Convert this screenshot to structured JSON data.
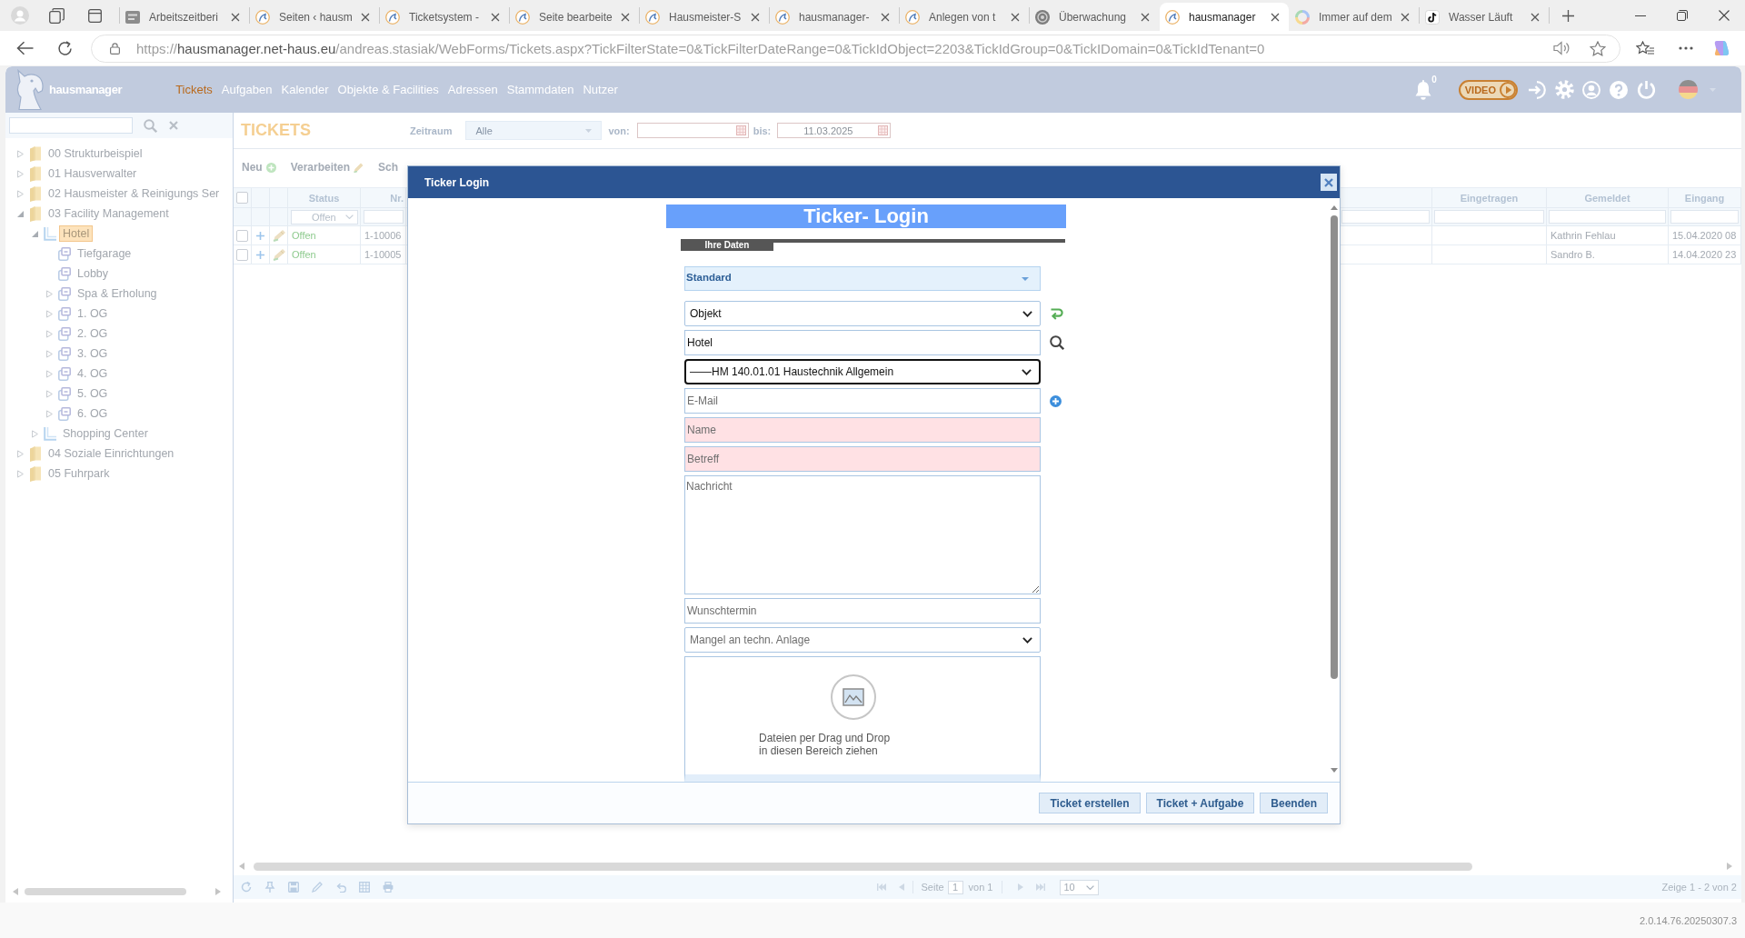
{
  "browser": {
    "tabs": [
      {
        "label": "Arbeitszeitberi",
        "kind": "tile",
        "selected": false
      },
      {
        "label": "Seiten ‹ hausm",
        "kind": "logo",
        "selected": false
      },
      {
        "label": "Ticketsystem -",
        "kind": "logo",
        "selected": false
      },
      {
        "label": "Seite bearbeite",
        "kind": "logo",
        "selected": false
      },
      {
        "label": "Hausmeister-S",
        "kind": "logo",
        "selected": false
      },
      {
        "label": "hausmanager-",
        "kind": "logo",
        "selected": false
      },
      {
        "label": "Anlegen von t",
        "kind": "logo",
        "selected": false
      },
      {
        "label": "Überwachung",
        "kind": "ring",
        "selected": false
      },
      {
        "label": "hausmanager",
        "kind": "logo",
        "selected": true
      },
      {
        "label": "Immer auf dem",
        "kind": "colors",
        "selected": false
      },
      {
        "label": "Wasser Läuft",
        "kind": "note",
        "selected": false
      }
    ],
    "address": {
      "scheme": "https://",
      "host": "hausmanager.net-haus.eu",
      "path": "/andreas.stasiak/WebForms/Tickets.aspx?TickFilterState=0&TickFilterDateRange=0&TickIdObject=2203&TickIdGroup=0&TickIDomain=0&TickIdTenant=0"
    }
  },
  "app": {
    "brand": "hausmanager",
    "nav": [
      {
        "label": "Tickets",
        "selected": true
      },
      {
        "label": "Aufgaben",
        "selected": false
      },
      {
        "label": "Kalender",
        "selected": false
      },
      {
        "label": "Objekte & Facilities",
        "selected": false
      },
      {
        "label": "Adressen",
        "selected": false
      },
      {
        "label": "Stammdaten",
        "selected": false
      },
      {
        "label": "Nutzer",
        "selected": false
      }
    ],
    "notifications": "0",
    "video": "VIDEO"
  },
  "sidebar": {
    "tree": [
      {
        "label": "00 Strukturbeispiel",
        "kind": "folder",
        "has_children": true,
        "expanded": false,
        "selected": false
      },
      {
        "label": "01 Hausverwalter",
        "kind": "folder",
        "has_children": true,
        "expanded": false,
        "selected": false
      },
      {
        "label": "02 Hausmeister & Reinigungs Ser",
        "kind": "folder",
        "has_children": true,
        "expanded": false,
        "selected": false
      },
      {
        "label": "03 Facility Management",
        "kind": "folder",
        "has_children": true,
        "expanded": true,
        "selected": false,
        "children": [
          {
            "label": "Hotel",
            "kind": "site",
            "has_children": true,
            "expanded": true,
            "selected": true,
            "children": [
              {
                "label": "Tiefgarage",
                "kind": "area",
                "has_children": false,
                "expanded": false,
                "selected": false
              },
              {
                "label": "Lobby",
                "kind": "area",
                "has_children": false,
                "expanded": false,
                "selected": false
              },
              {
                "label": "Spa & Erholung",
                "kind": "area",
                "has_children": true,
                "expanded": false,
                "selected": false
              },
              {
                "label": "1. OG",
                "kind": "area",
                "has_children": true,
                "expanded": false,
                "selected": false
              },
              {
                "label": "2. OG",
                "kind": "area",
                "has_children": true,
                "expanded": false,
                "selected": false
              },
              {
                "label": "3. OG",
                "kind": "area",
                "has_children": true,
                "expanded": false,
                "selected": false
              },
              {
                "label": "4. OG",
                "kind": "area",
                "has_children": true,
                "expanded": false,
                "selected": false
              },
              {
                "label": "5. OG",
                "kind": "area",
                "has_children": true,
                "expanded": false,
                "selected": false
              },
              {
                "label": "6. OG",
                "kind": "area",
                "has_children": true,
                "expanded": false,
                "selected": false
              }
            ]
          },
          {
            "label": "Shopping Center",
            "kind": "site",
            "has_children": true,
            "expanded": false,
            "selected": false
          }
        ]
      },
      {
        "label": "04 Soziale Einrichtungen",
        "kind": "folder",
        "has_children": true,
        "expanded": false,
        "selected": false
      },
      {
        "label": "05 Fuhrpark",
        "kind": "folder",
        "has_children": true,
        "expanded": false,
        "selected": false
      }
    ]
  },
  "tickets": {
    "title": "TICKETS",
    "range": {
      "label": "Zeitraum",
      "value": "Alle"
    },
    "from": {
      "label": "von:"
    },
    "to": {
      "label": "bis:",
      "value": "11.03.2025"
    },
    "toolbar": [
      {
        "label": "Neu",
        "kind": "add"
      },
      {
        "label": "Verarbeiten",
        "kind": "edit"
      },
      {
        "label": "Sch",
        "kind": "plain"
      }
    ],
    "table": {
      "all_checked": false,
      "left_columns": [
        {
          "label": "Status",
          "filter": "Offen"
        },
        {
          "label": "Nr."
        }
      ],
      "right_columns": [
        {
          "label": "Eingetragen"
        },
        {
          "label": "Gemeldet"
        },
        {
          "label": "Eingang"
        }
      ],
      "rows": [
        {
          "checked": false,
          "status": "Offen",
          "number": "1-10006",
          "reported": "Kathrin Fehlau",
          "received": "15.04.2020 08"
        },
        {
          "checked": false,
          "status": "Offen",
          "number": "1-10005",
          "reported": "Sandro B.",
          "received": "14.04.2020 23"
        }
      ]
    },
    "pager": {
      "page_label": "Seite",
      "page": "1",
      "of_label": "von 1",
      "page_size": "10",
      "summary": "Zeige 1 - 2 von 2"
    }
  },
  "version": "2.0.14.76.20250307.3",
  "dialog": {
    "title": "Ticker Login",
    "banner": "Ticker- Login",
    "section": "Ihre Daten",
    "fields": [
      {
        "kind": "dropdown",
        "value": "Standard",
        "focused": false,
        "required": false
      },
      {
        "kind": "select",
        "value": "Objekt",
        "side_button": {
          "kind": "reload"
        },
        "focused": false,
        "required": false
      },
      {
        "kind": "input",
        "value": "Hotel",
        "side_button": {
          "kind": "search"
        },
        "focused": false,
        "required": false
      },
      {
        "kind": "select",
        "value": "——HM 140.01.01 Haustechnik Allgemein",
        "focused": true,
        "required": false
      },
      {
        "kind": "input",
        "placeholder": "E-Mail",
        "side_button": {
          "kind": "add"
        },
        "focused": false,
        "required": false
      },
      {
        "kind": "input",
        "placeholder": "Name",
        "focused": false,
        "required": true
      },
      {
        "kind": "input",
        "placeholder": "Betreff",
        "focused": false,
        "required": true
      },
      {
        "kind": "textarea",
        "placeholder": "Nachricht",
        "focused": false,
        "required": false
      },
      {
        "kind": "input",
        "placeholder": "Wunschtermin",
        "focused": false,
        "required": false
      },
      {
        "kind": "select",
        "placeholder": "Mangel an techn. Anlage",
        "focused": false,
        "required": false
      }
    ],
    "dropzone": {
      "hint": "Dateien per Drag und Drop\nin diesen Bereich ziehen"
    },
    "buttons": [
      "Ticket erstellen",
      "Ticket + Aufgabe",
      "Beenden"
    ]
  }
}
